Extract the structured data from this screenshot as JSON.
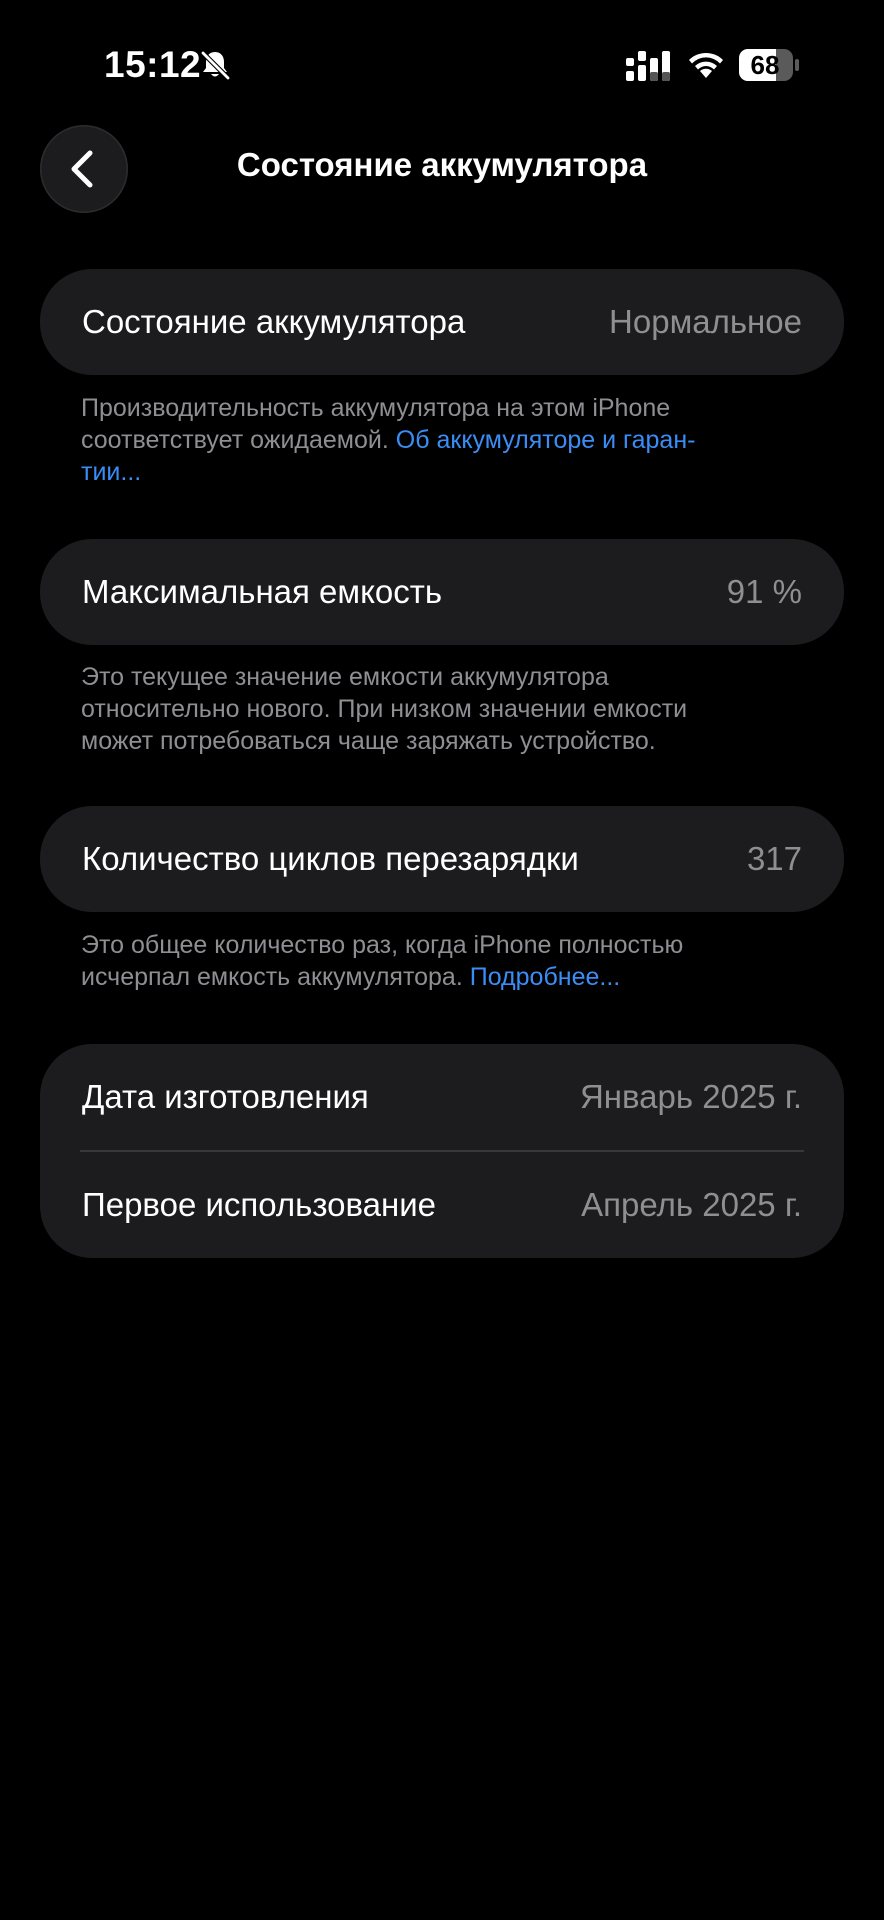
{
  "status_bar": {
    "time": "15:12",
    "battery_level": "68"
  },
  "nav": {
    "title": "Состояние аккумулятора"
  },
  "health": {
    "label": "Состояние аккумулятора",
    "value": "Нормальное",
    "footnote_line1": "Производительность аккумулятора на этом iPhone",
    "footnote_line2": "соответствует ожидаемой.",
    "link_part1": "Об аккумуляторе и гаран-",
    "link_part2": "тии..."
  },
  "capacity": {
    "label": "Максимальная емкость",
    "value": "91 %",
    "footnote_line1": "Это текущее значение емкости аккумулятора",
    "footnote_line2": "относительно нового. При низком значении емкости",
    "footnote_line3": "может потребоваться чаще заряжать устройство."
  },
  "cycles": {
    "label": "Количество циклов перезарядки",
    "value": "317",
    "footnote_line1": "Это общее количество раз, когда iPhone полностью",
    "footnote_line2": "исчерпал емкость аккумулятора.",
    "link": "Подробнее..."
  },
  "dates": {
    "manufacture_label": "Дата изготовления",
    "manufacture_value": "Январь 2025 г.",
    "first_use_label": "Первое использование",
    "first_use_value": "Апрель 2025 г."
  },
  "colors": {
    "background": "#000000",
    "card": "#1c1c1e",
    "secondary_text": "#8e8e93",
    "link": "#3b8df6"
  }
}
